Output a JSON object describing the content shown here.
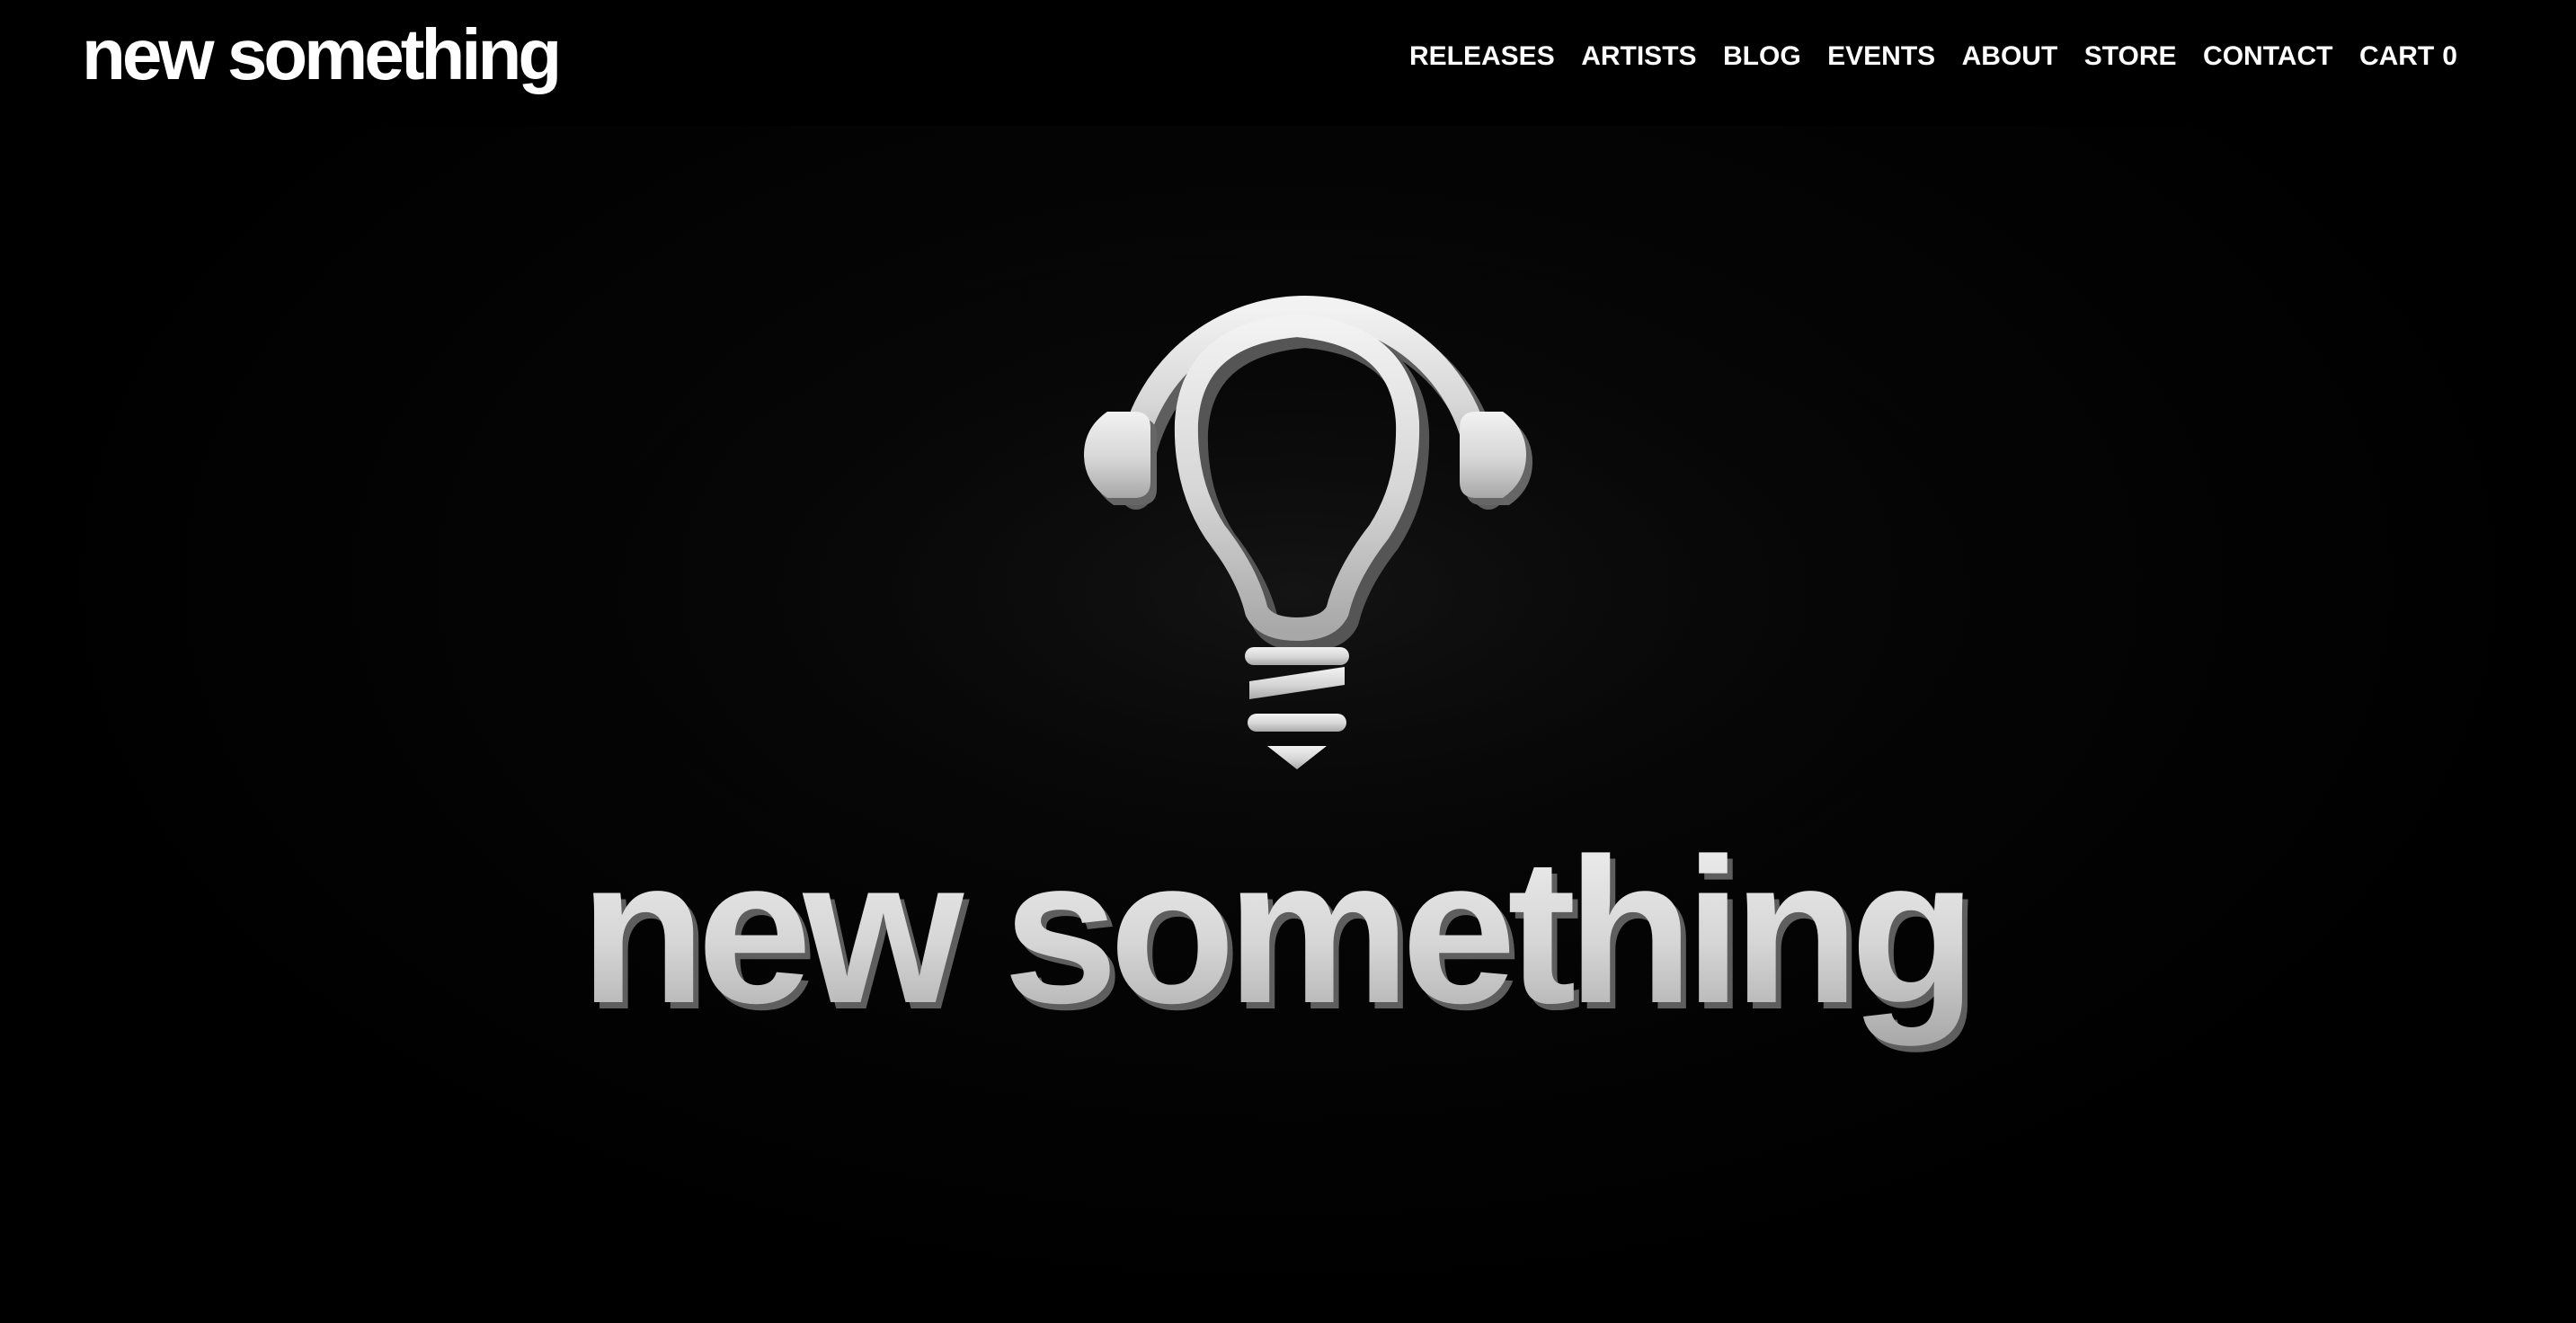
{
  "header": {
    "logo_text": "new something"
  },
  "nav": {
    "items": [
      {
        "label": "RELEASES"
      },
      {
        "label": "ARTISTS"
      },
      {
        "label": "BLOG"
      },
      {
        "label": "EVENTS"
      },
      {
        "label": "ABOUT"
      },
      {
        "label": "STORE"
      },
      {
        "label": "CONTACT"
      }
    ],
    "cart": {
      "label": "CART",
      "count": "0"
    }
  },
  "hero": {
    "wordmark": "new something",
    "icon": "lightbulb-headphones-icon"
  },
  "colors": {
    "background": "#000000",
    "text": "#ffffff",
    "logo_3d_face": "#dcdcdc",
    "logo_3d_shade": "#7a7a7a"
  }
}
